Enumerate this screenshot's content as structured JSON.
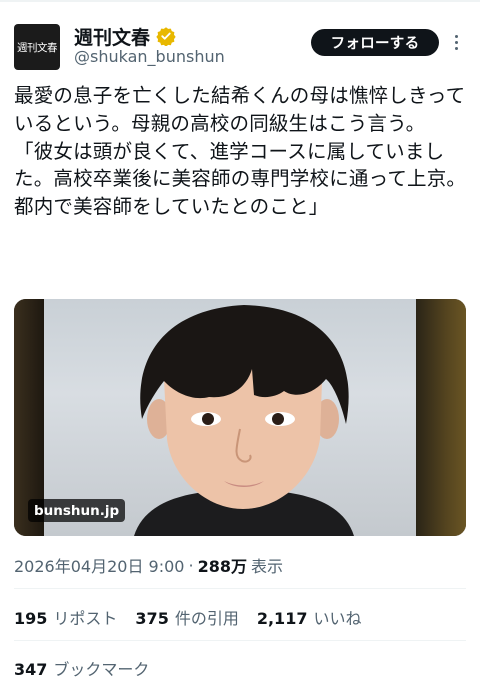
{
  "author": {
    "avatar_text": "週刊文春",
    "display_name": "週刊文春",
    "handle": "@shukan_bunshun",
    "verified_color": "#e8b800"
  },
  "actions": {
    "follow_label": "フォローする",
    "more_icon": "more-dots-icon"
  },
  "tweet": {
    "text": "最愛の息子を亡くした結希くんの母は憔悴しきっているという。母親の高校の同級生はこう言う。\n「彼女は頭が良くて、進学コースに属していました。高校卒業後に美容師の専門学校に通って上京。都内で美容師をしていたとのこと」",
    "media_badge": "bunshun.jp"
  },
  "meta": {
    "timestamp": "2026年04月20日 9:00",
    "separator": "·",
    "views_count": "288万",
    "views_label": "表示"
  },
  "stats": [
    {
      "count": "195",
      "label": "リポスト"
    },
    {
      "count": "375",
      "label": "件の引用"
    },
    {
      "count": "2,117",
      "label": "いいね"
    }
  ],
  "bookmarks": {
    "count": "347",
    "label": "ブックマーク"
  }
}
